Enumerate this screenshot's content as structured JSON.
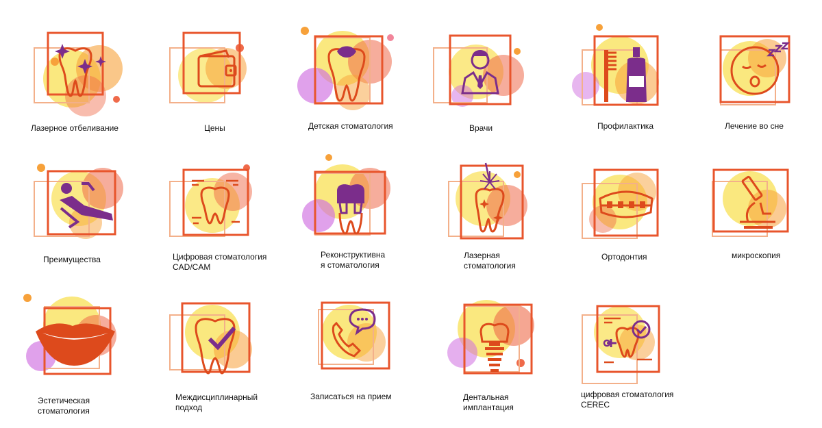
{
  "colors": {
    "frame": "#e8552c",
    "frame_faint": "#f3b08a",
    "icon_orange": "#dd4a1c",
    "icon_purple": "#7b2d8b",
    "splash_yellow": "#f9e25f",
    "splash_orange": "#f7a13a",
    "splash_red": "#ef6a4a",
    "splash_pink": "#f2859a",
    "splash_violet": "#cf6ee0"
  },
  "items": [
    {
      "label": "Лазерное отбеливание",
      "icon": "sparkle-tooth-icon"
    },
    {
      "label": "Цены",
      "icon": "wallet-icon"
    },
    {
      "label": "Детская стоматология",
      "icon": "baby-tooth-icon"
    },
    {
      "label": "Врачи",
      "icon": "doctor-icon"
    },
    {
      "label": "Профилактика",
      "icon": "toothbrush-paste-icon"
    },
    {
      "label": "Лечение во сне",
      "icon": "sleeping-face-icon"
    },
    {
      "label": "Преимущества",
      "icon": "dental-chair-icon"
    },
    {
      "label": "Цифровая стоматология\nCAD/CAM",
      "icon": "cad-cam-tooth-icon"
    },
    {
      "label": "Реконструктивна\nя стоматология",
      "icon": "crown-tooth-icon"
    },
    {
      "label": "Лазерная\nстоматология",
      "icon": "laser-tooth-icon"
    },
    {
      "label": "Ортодонтия",
      "icon": "braces-icon"
    },
    {
      "label": "микроскопия",
      "icon": "microscope-icon"
    },
    {
      "label": "Эстетическая\nстоматология",
      "icon": "smile-lips-icon"
    },
    {
      "label": "Междисциплинарный\nподход",
      "icon": "checked-tooth-icon"
    },
    {
      "label": "Записаться на прием",
      "icon": "phone-chat-icon"
    },
    {
      "label": "Дентальная\nимплантация",
      "icon": "implant-icon"
    },
    {
      "label": "цифровая стоматология\nCEREC",
      "icon": "cerec-scan-icon"
    }
  ]
}
